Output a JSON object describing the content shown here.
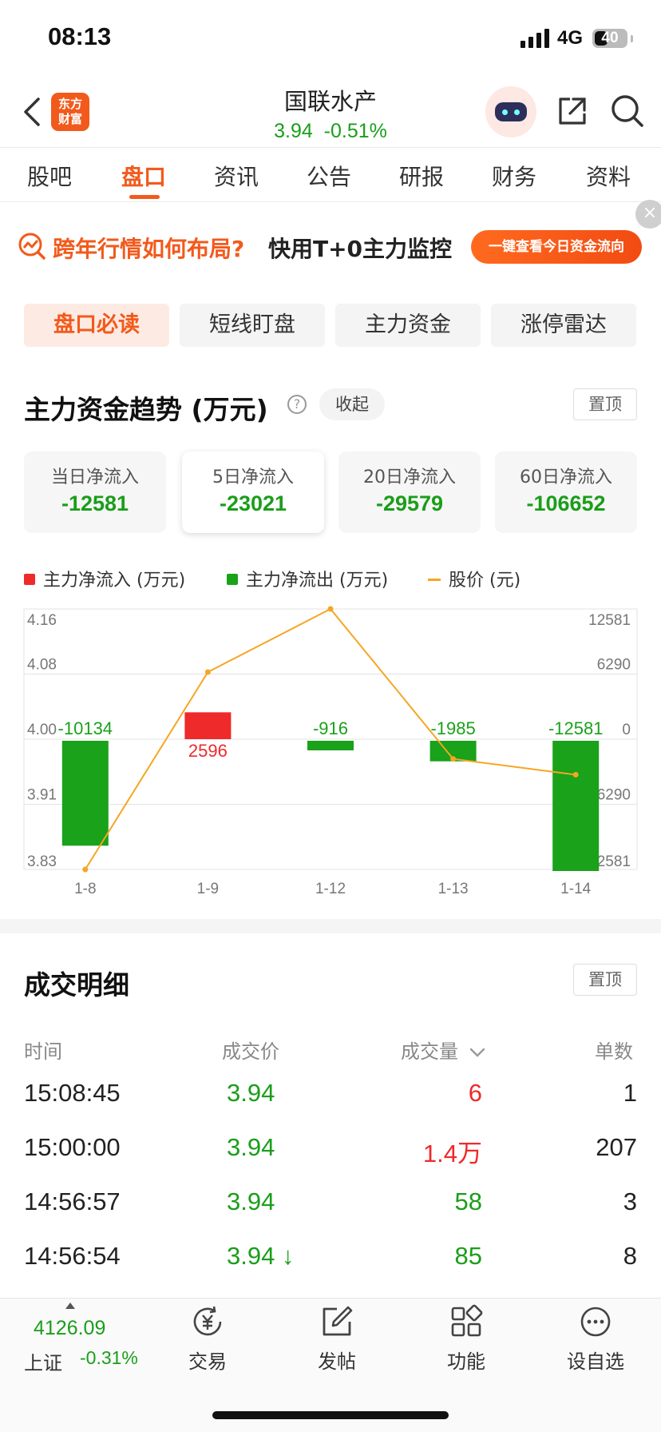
{
  "status": {
    "time": "08:13",
    "network": "4G",
    "battery": "40",
    "battery_level": 0.4
  },
  "header": {
    "logo_text": "东方财富",
    "stock_name": "国联水产",
    "price": "3.94",
    "change_pct": "-0.51%"
  },
  "tabs": [
    "股吧",
    "盘口",
    "资讯",
    "公告",
    "研报",
    "财务",
    "资料"
  ],
  "active_tab": 1,
  "banner": {
    "text_highlight": "跨年行情如何布局?",
    "text_main": "快用T+0主力监控",
    "button": "一键查看今日资金流向",
    "close": "×"
  },
  "subtabs": [
    "盘口必读",
    "短线盯盘",
    "主力资金",
    "涨停雷达"
  ],
  "fund_section": {
    "title": "主力资金趋势 (万元)",
    "help": "?",
    "collapse_label": "收起",
    "pin_label": "置顶",
    "cards": [
      {
        "label": "当日净流入",
        "value": "-12581"
      },
      {
        "label": "5日净流入",
        "value": "-23021"
      },
      {
        "label": "20日净流入",
        "value": "-29579"
      },
      {
        "label": "60日净流入",
        "value": "-106652"
      }
    ],
    "legend": {
      "inflow": "主力净流入 (万元)",
      "outflow": "主力净流出 (万元)",
      "price": "股价 (元)"
    }
  },
  "chart_data": {
    "type": "bar",
    "categories": [
      "1-8",
      "1-9",
      "1-12",
      "1-13",
      "1-14"
    ],
    "series": [
      {
        "name": "主力净流入 (万元)",
        "values": [
          -10134,
          2596,
          -916,
          -1985,
          -12581
        ],
        "bar_labels": [
          "-10134",
          "2596",
          "-916",
          "-1985",
          "-12581"
        ]
      },
      {
        "name": "股价 (元)",
        "values": [
          3.83,
          4.08,
          4.16,
          3.97,
          3.95
        ]
      }
    ],
    "y_left_ticks": [
      "4.16",
      "4.08",
      "4.00",
      "3.91",
      "3.83"
    ],
    "y_left_range": [
      3.83,
      4.16
    ],
    "y_right_ticks": [
      "12581",
      "6290",
      "0",
      "-6290",
      "-12581"
    ],
    "y_right_range": [
      -12581,
      12581
    ],
    "colors": {
      "inflow": "#ee2a2a",
      "outflow": "#19a21a",
      "price": "#f5a623"
    },
    "grid": true
  },
  "trades": {
    "title": "成交明细",
    "pin_label": "置顶",
    "headers": {
      "time": "时间",
      "price": "成交价",
      "volume": "成交量",
      "count": "单数"
    },
    "rows": [
      {
        "time": "15:08:45",
        "price": "3.94",
        "volume": "6",
        "count": "1"
      },
      {
        "time": "15:00:00",
        "price": "3.94",
        "volume": "1.4万",
        "count": "207"
      },
      {
        "time": "14:56:57",
        "price": "3.94",
        "volume": "58",
        "count": "3"
      },
      {
        "time": "14:56:54",
        "price": "3.94 ↓",
        "volume": "85",
        "count": "8"
      }
    ]
  },
  "bottom_bar": {
    "index_value": "4126.09",
    "index_name": "上证",
    "index_change": "-0.31%",
    "items": [
      "交易",
      "发帖",
      "功能",
      "设自选"
    ]
  }
}
